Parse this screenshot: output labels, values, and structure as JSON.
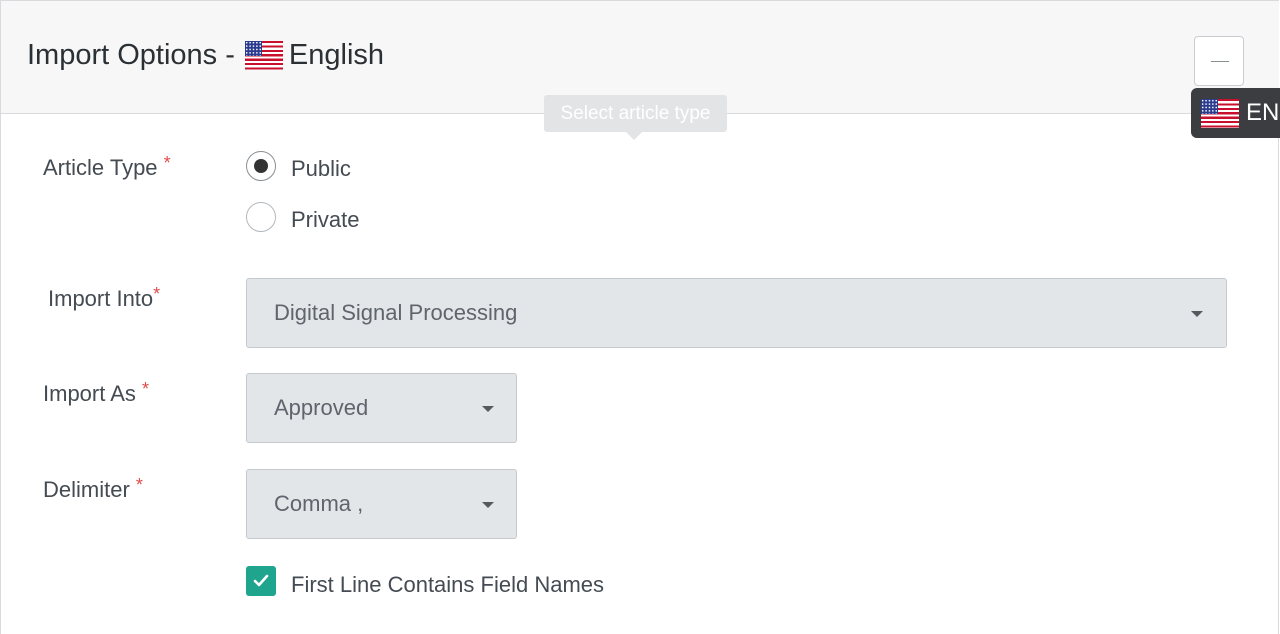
{
  "header": {
    "title_prefix": "Import Options -",
    "title_language": "English",
    "flag_icon": "us-flag-icon",
    "collapse_icon": "minus-icon"
  },
  "language_badge": {
    "code": "EN",
    "flag_icon": "us-flag-icon"
  },
  "tooltip": {
    "text": "Select article type"
  },
  "form": {
    "article_type": {
      "label": "Article Type",
      "required_mark": "*",
      "options": [
        {
          "label": "Public",
          "selected": true
        },
        {
          "label": "Private",
          "selected": false
        }
      ]
    },
    "import_into": {
      "label": "Import Into",
      "required_mark": "*",
      "value": "Digital Signal Processing"
    },
    "import_as": {
      "label": "Import As",
      "required_mark": "*",
      "value": "Approved"
    },
    "delimiter": {
      "label": "Delimiter",
      "required_mark": "*",
      "value": "Comma ,"
    },
    "first_line_field_names": {
      "label": "First Line Contains Field Names",
      "checked": true
    }
  },
  "colors": {
    "checkbox_accent": "#1fa58e",
    "required": "#e14a4a",
    "select_bg": "#e3e6e9",
    "badge_bg": "#3b3d40"
  }
}
